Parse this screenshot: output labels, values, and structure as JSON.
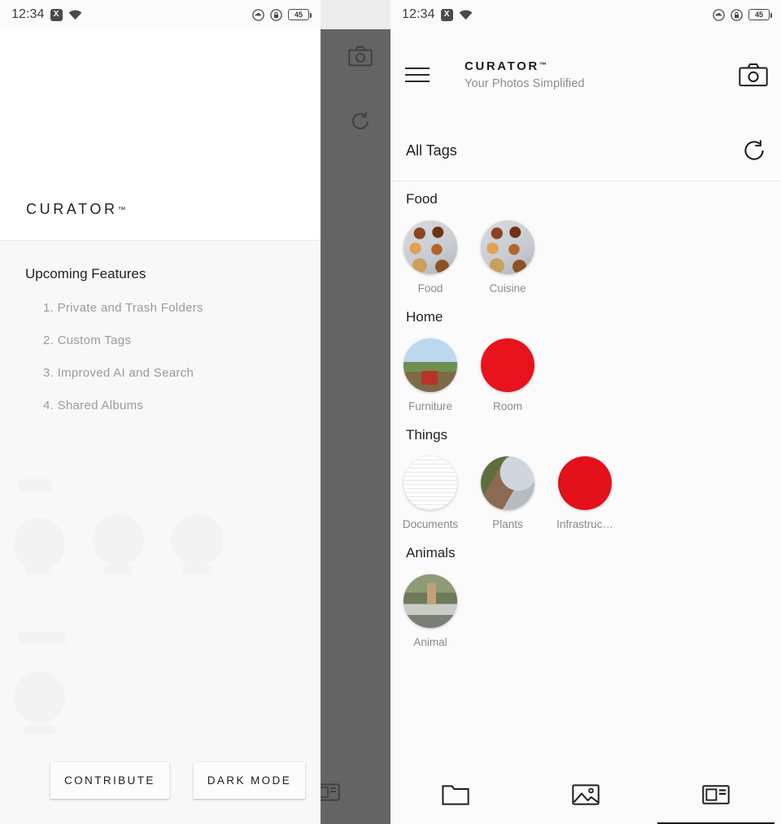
{
  "status_bar": {
    "time": "12:34",
    "x_badge": "X",
    "battery_level": "45",
    "icons": [
      "x-badge-icon",
      "wifi-icon",
      "cloud-icon",
      "lock-icon",
      "battery-icon"
    ]
  },
  "drawer": {
    "brand": "CURATOR",
    "trademark": "™",
    "section_title": "Upcoming Features",
    "features": [
      "1. Private and Trash Folders",
      "2. Custom Tags",
      "3. Improved AI and Search",
      "4. Shared Albums"
    ],
    "buttons": [
      {
        "label": "CONTRIBUTE",
        "name": "contribute-button"
      },
      {
        "label": "DARK MODE",
        "name": "dark-mode-button"
      }
    ]
  },
  "app": {
    "brand": "CURATOR",
    "trademark": "™",
    "tagline": "Your Photos Simplified",
    "menu_icon": "hamburger-menu-icon",
    "camera_icon": "camera-icon",
    "tagbar": {
      "title": "All Tags",
      "refresh_icon": "refresh-icon"
    },
    "sections": [
      {
        "title": "Food",
        "items": [
          {
            "label": "Food",
            "thumb": "th-food"
          },
          {
            "label": "Cuisine",
            "thumb": "th-food"
          }
        ]
      },
      {
        "title": "Home",
        "items": [
          {
            "label": "Furniture",
            "thumb": "th-furniture"
          },
          {
            "label": "Room",
            "thumb": "th-room"
          }
        ]
      },
      {
        "title": "Things",
        "items": [
          {
            "label": "Documents",
            "thumb": "th-documents"
          },
          {
            "label": "Plants",
            "thumb": "th-plants"
          },
          {
            "label": "Infrastruc…",
            "thumb": "th-infra"
          }
        ]
      },
      {
        "title": "Animals",
        "items": [
          {
            "label": "Animal",
            "thumb": "th-animal"
          }
        ]
      }
    ],
    "bottom_nav": [
      {
        "name": "nav-folders",
        "icon": "folder-icon",
        "active": false
      },
      {
        "name": "nav-photos",
        "icon": "image-icon",
        "active": false
      },
      {
        "name": "nav-tags",
        "icon": "article-card-icon",
        "active": true
      }
    ]
  },
  "colors": {
    "accent_red": "#e3111a",
    "scrim": "#646464",
    "app_bg": "#fbfbfb",
    "text_primary": "#1f1f1f",
    "text_muted": "#8a8a8a"
  }
}
